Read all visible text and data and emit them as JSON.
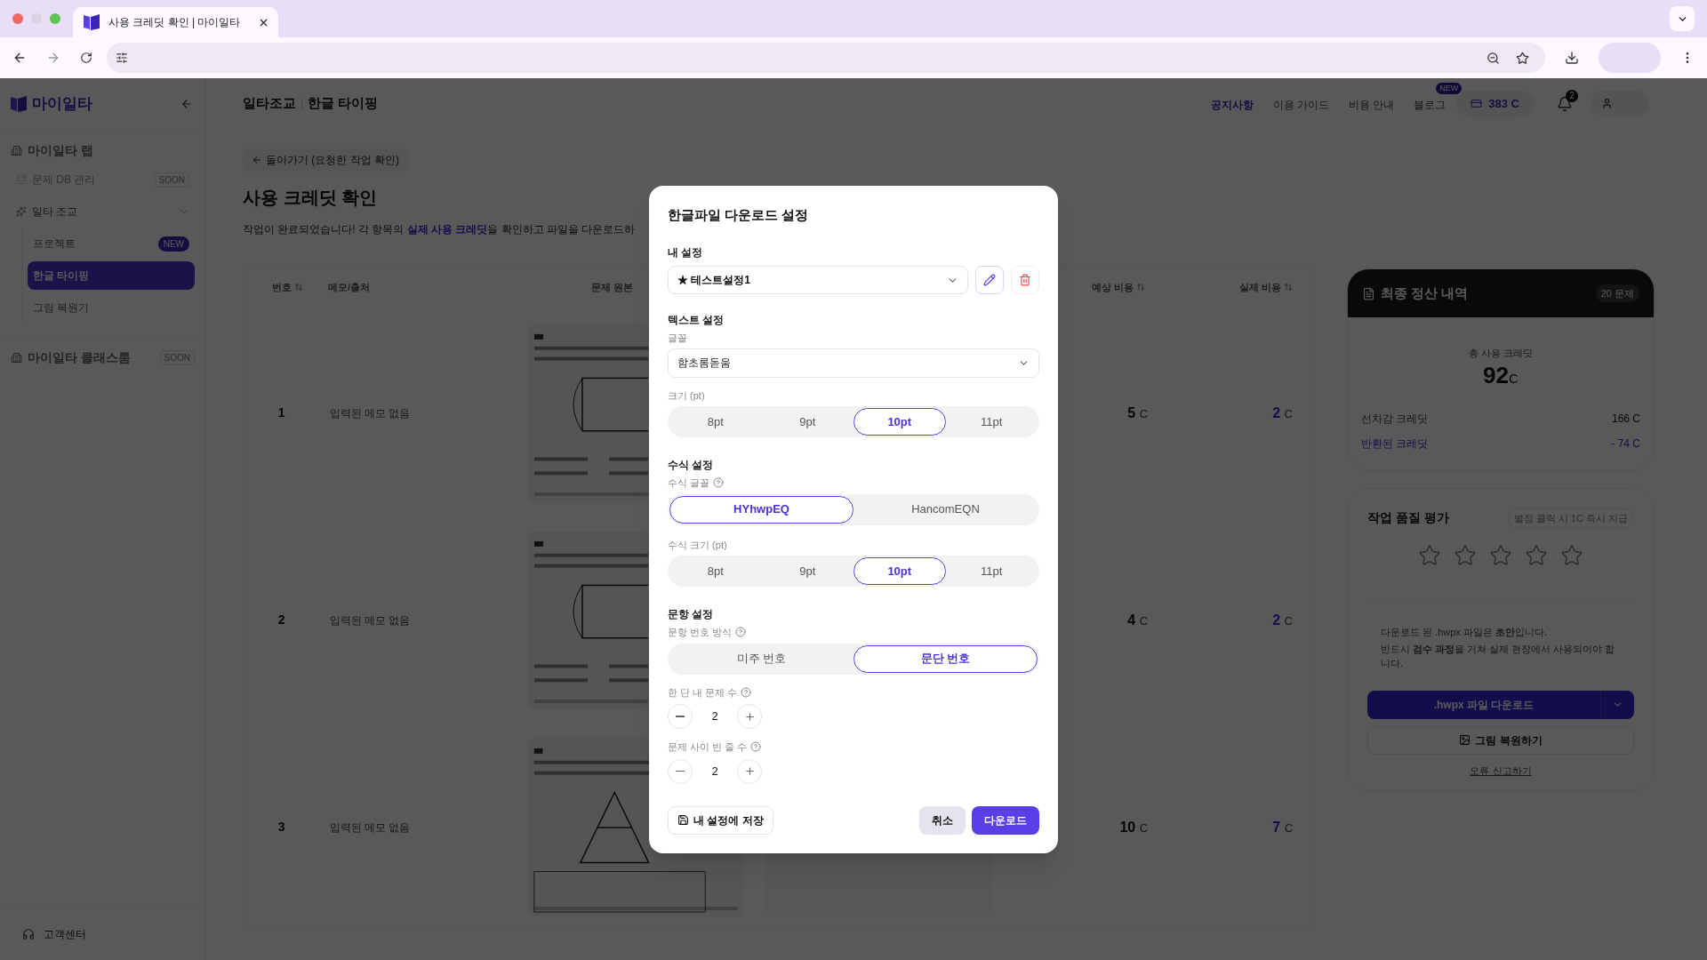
{
  "browser": {
    "tab_title": "사용 크레딧 확인 | 마이일타"
  },
  "sidebar": {
    "logo": "마이일타",
    "sections": [
      {
        "label": "마이일타 랩",
        "items": [
          {
            "label": "문제 DB 관리",
            "badge": "SOON",
            "disabled": true,
            "expanded": false
          },
          {
            "label": "일타 조교",
            "disabled": false,
            "expanded": true,
            "children": [
              {
                "label": "프로젝트",
                "badge": "NEW",
                "selected": false
              },
              {
                "label": "한글 타이핑",
                "selected": true
              },
              {
                "label": "그림 복원기",
                "selected": false
              }
            ]
          }
        ]
      },
      {
        "label": "마이일타 클래스룸",
        "badge": "SOON"
      }
    ],
    "footer": "고객센터"
  },
  "header": {
    "breadcrumb": [
      "일타조교",
      "한글 타이핑"
    ],
    "nav": [
      {
        "label": "공지사항",
        "selected": true
      },
      {
        "label": "이용 가이드",
        "selected": false
      },
      {
        "label": "비용 안내",
        "selected": false
      },
      {
        "label": "블로그",
        "selected": false,
        "badge": "NEW"
      }
    ],
    "credits": "383 C",
    "notifications": "2"
  },
  "main": {
    "back": "돌아가기 (요청한 작업 확인)",
    "title": "사용 크레딧 확인",
    "description": [
      {
        "text": "작업이 완료되었습니다! 각 항목의 ",
        "highlight": false
      },
      {
        "text": "실제 사용 크레딧",
        "highlight": true
      },
      {
        "text": "을 확인하고 파일을 다운로드하",
        "highlight": false
      }
    ],
    "table": {
      "columns": [
        {
          "label": "번호",
          "sortable": true
        },
        {
          "label": "메모/출처",
          "sortable": false
        },
        {
          "label": "문제 원본",
          "sortable": false
        },
        {
          "label": "예상 비용",
          "sortable": true
        },
        {
          "label": "실제 비용",
          "sortable": true
        }
      ],
      "rows": [
        {
          "number": "1",
          "memo": "입력된 메모 없음",
          "expected": "5",
          "expected_unit": "C",
          "actual": "2",
          "actual_unit": "C"
        },
        {
          "number": "2",
          "memo": "입력된 메모 없음",
          "expected": "4",
          "expected_unit": "C",
          "actual": "2",
          "actual_unit": "C"
        },
        {
          "number": "3",
          "memo": "입력된 메모 없음",
          "expected": "10",
          "expected_unit": "C",
          "actual": "7",
          "actual_unit": "C"
        }
      ]
    }
  },
  "summary": {
    "title": "최종 정산 내역",
    "badge": "20 문제",
    "total_label": "총 사용 크레딧",
    "total": "92",
    "total_unit": "C",
    "lines": [
      {
        "label": "선차감 크레딧",
        "value": "166 C",
        "kind": "normal"
      },
      {
        "label": "반환된 크레딧",
        "value": "- 74 C",
        "kind": "refund"
      }
    ]
  },
  "rating": {
    "title": "작업 품질 평가",
    "hint": "별점 클릭 시 1C 즉시 지급",
    "stars": 0,
    "notice": [
      "다운로드 된 .hwpx 파일은 **초안**입니다.",
      "반드시 **검수 과정**을 거쳐 실제 현장에서 사용되어야 합니다."
    ],
    "download": ".hwpx 파일 다운로드",
    "restore": "그림 복원하기",
    "report": "오류 신고하기"
  },
  "modal": {
    "title": "한글파일 다운로드 설정",
    "my_settings": {
      "label": "내 설정",
      "value": "★ 테스트설정1"
    },
    "text_settings": {
      "heading": "텍스트 설정",
      "font_label": "글꼴",
      "font_value": "함초롬돋움",
      "size_label": "크기 (pt)",
      "sizes": [
        {
          "label": "8pt",
          "selected": false
        },
        {
          "label": "9pt",
          "selected": false
        },
        {
          "label": "10pt",
          "selected": true
        },
        {
          "label": "11pt",
          "selected": false
        }
      ]
    },
    "equation_settings": {
      "heading": "수식 설정",
      "font_label": "수식 글꼴",
      "fonts": [
        {
          "label": "HYhwpEQ",
          "selected": true
        },
        {
          "label": "HancomEQN",
          "selected": false
        }
      ],
      "size_label": "수식 크기 (pt)",
      "sizes": [
        {
          "label": "8pt",
          "selected": false
        },
        {
          "label": "9pt",
          "selected": false
        },
        {
          "label": "10pt",
          "selected": true
        },
        {
          "label": "11pt",
          "selected": false
        }
      ]
    },
    "question_settings": {
      "heading": "문항 설정",
      "numbering_label": "문항 번호 방식",
      "numbering": [
        {
          "label": "미주 번호",
          "selected": false
        },
        {
          "label": "문단 번호",
          "selected": true
        }
      ],
      "steppers": [
        {
          "label": "한 단 내 문제 수",
          "value": "2"
        },
        {
          "label": "문제 사이 빈 줄 수",
          "value": "2"
        }
      ]
    },
    "save": "내 설정에 저장",
    "cancel": "취소",
    "download": "다운로드"
  }
}
